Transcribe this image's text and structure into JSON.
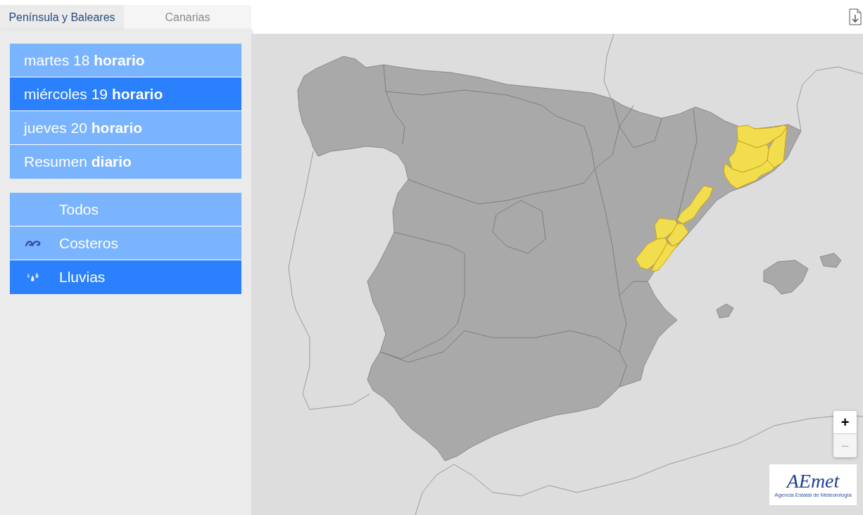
{
  "region_tabs": [
    {
      "label": "Península y Baleares",
      "selected": true
    },
    {
      "label": "Canarias",
      "selected": false
    }
  ],
  "day_menu": [
    {
      "label": "martes 18 **horario**",
      "selected": false
    },
    {
      "label": "miércoles 19 **horario**",
      "selected": true
    },
    {
      "label": "jueves 20 **horario**",
      "selected": false
    },
    {
      "label": "Resumen **diario**",
      "selected": false
    }
  ],
  "warning_types": [
    {
      "label": "Todos",
      "kind": "all",
      "selected": false
    },
    {
      "label": "Costeros",
      "kind": "coastal",
      "selected": false
    },
    {
      "label": "Lluvias",
      "kind": "rain",
      "selected": true
    }
  ],
  "map": {
    "zoom_controls": [
      {
        "label": "+",
        "disabled": false
      },
      {
        "label": "−",
        "disabled": true
      }
    ],
    "logo": {
      "wordmark": "AEmet",
      "subtitle": "Agencia Estatal de Meteorología"
    }
  }
}
